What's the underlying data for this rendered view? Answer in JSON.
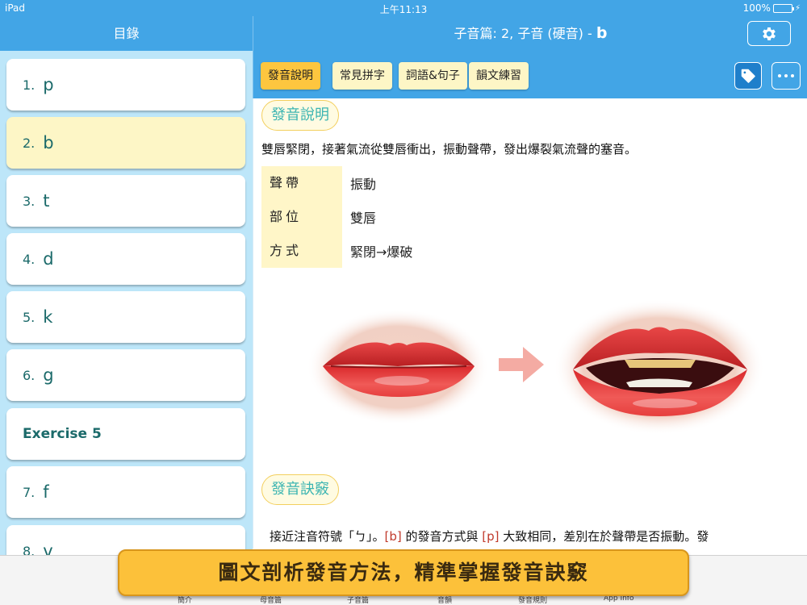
{
  "status_bar": {
    "device": "iPad",
    "time": "上午11:13",
    "battery": "100%"
  },
  "sidebar": {
    "title": "目錄",
    "items": [
      {
        "num": "1.",
        "label": "p"
      },
      {
        "num": "2.",
        "label": "b"
      },
      {
        "num": "3.",
        "label": "t"
      },
      {
        "num": "4.",
        "label": "d"
      },
      {
        "num": "5.",
        "label": "k"
      },
      {
        "num": "6.",
        "label": "g"
      },
      {
        "num": "",
        "label": "Exercise 5"
      },
      {
        "num": "7.",
        "label": "f"
      },
      {
        "num": "8.",
        "label": "v"
      }
    ],
    "selected_index": 1
  },
  "header": {
    "title": "子音篇: 2, 子音 (硬音) -",
    "title_letter": "b",
    "settings_icon": "gear-icon"
  },
  "toolbar": {
    "tabs": [
      {
        "label": "發音說明",
        "active": true
      },
      {
        "label": "常見拼字",
        "active": false
      },
      {
        "label": "詞語&句子",
        "active": false
      },
      {
        "label": "韻文練習",
        "active": false
      }
    ],
    "tag_icon": "tag-icon",
    "more_icon": "more-icon"
  },
  "content": {
    "section1": "發音說明",
    "description": "雙唇緊閉，接著氣流從雙唇衝出，振動聲帶，發出爆裂氣流聲的塞音。",
    "props": [
      {
        "label": "聲帶",
        "value": "振動"
      },
      {
        "label": "部位",
        "value": "雙唇"
      },
      {
        "label": "方式",
        "value": "緊閉→爆破"
      }
    ],
    "section2": "發音訣竅",
    "tip": {
      "part1": "接近注音符號「ㄅ」。",
      "b": "[b]",
      "part2": " 的發音方式與 ",
      "p": "[p]",
      "part3": " 大致相同，差別在於聲帶是否振動。發"
    }
  },
  "tabbar": {
    "items": [
      "簡介",
      "母音篇",
      "子音篇",
      "音韻",
      "發音規則",
      "App Info"
    ]
  },
  "banner": {
    "text": "圖文剖析發音方法，精準掌握發音訣竅"
  },
  "colors": {
    "primary_blue": "#42a5e6",
    "sidebar_bg": "#bde6f9",
    "selected_bg": "#fdf6c6",
    "active_tab": "#fdc63f",
    "banner": "#fcc13a",
    "accent_teal": "#3cb5b2"
  }
}
